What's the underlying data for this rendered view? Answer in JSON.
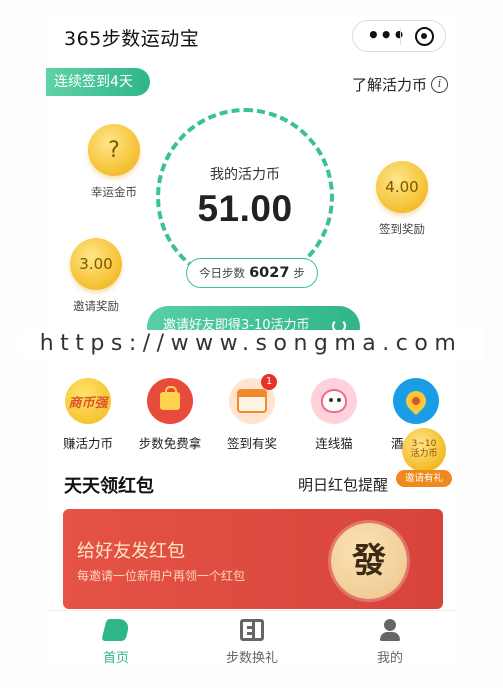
{
  "header": {
    "title": "365步数运动宝",
    "more_icon": "more-dots-icon",
    "close_icon": "target-circle-icon"
  },
  "top": {
    "checkin_badge": "连续签到4天",
    "learn_link": "了解活力币",
    "coins": {
      "lucky": {
        "value": "?",
        "label": "幸运金币"
      },
      "checkin": {
        "value": "4.00",
        "label": "签到奖励"
      },
      "invite": {
        "value": "3.00",
        "label": "邀请奖励"
      }
    },
    "ring": {
      "title": "我的活力币",
      "value": "51.00"
    },
    "steps": {
      "label": "今日步数",
      "value": "6027",
      "unit": "步"
    },
    "invite_banner": "邀请好友即得3-10活力币"
  },
  "watermark": "https://www.songma.com",
  "icon_row": [
    {
      "label": "赚活力币",
      "icon": "coin-earn-icon",
      "text": "商币强"
    },
    {
      "label": "步数免费拿",
      "icon": "shopping-bag-icon"
    },
    {
      "label": "签到有奖",
      "icon": "calendar-icon",
      "badge": "1"
    },
    {
      "label": "连线猫",
      "icon": "cat-icon"
    },
    {
      "label": "酒店机票",
      "icon": "location-pin-icon"
    }
  ],
  "float_coin": {
    "range": "3~10",
    "unit": "活力币",
    "tag": "邀请有礼"
  },
  "section": {
    "title": "天天领红包",
    "link": "明日红包提醒"
  },
  "red_card": {
    "title": "给好友发红包",
    "subtitle": "每邀请一位新用户再领一个红包",
    "badge": "發"
  },
  "tabbar": [
    {
      "label": "首页",
      "icon": "shoe-icon",
      "active": true
    },
    {
      "label": "步数换礼",
      "icon": "exchange-icon",
      "active": false
    },
    {
      "label": "我的",
      "icon": "person-icon",
      "active": false
    }
  ],
  "colors": {
    "accent": "#2fb58a",
    "red": "#d8443a",
    "gold": "#f6c53b"
  }
}
